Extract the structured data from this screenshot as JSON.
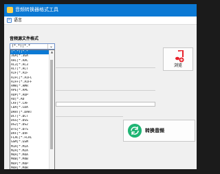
{
  "window": {
    "title": "音频转换器格式工具"
  },
  "menu": {
    "language_label": "语言"
  },
  "format_section": {
    "title": "音频源文件格式",
    "selected_value": "(*.*)|*.*",
    "options": [
      "(*.*)|*.*",
      "3GA|*.3GA",
      "AAC|*.AAC",
      "AC3|*.AC3",
      "ACT|*.ACT",
      "AIF|*.AIF",
      "AIFC|*.AIFC",
      "AIFF|*.AIFF",
      "AMR|*.AMR",
      "APE|*.APE",
      "AUP|*.AUP",
      "AU|*.AU",
      "CAF|*.CAF",
      "CDA|*.CDA",
      "DART|*.DART",
      "DCT|*.DCT",
      "DSS|*.DSS",
      "DS2|*.DS2",
      "DTS|*.DTS",
      "DVF|*.DVF",
      "FLAC|*.FLAC",
      "GSM|*.GSM",
      "M1A|*.M1A",
      "M2A|*.M2A",
      "M4A|*.M4A",
      "M4B|*.M4B",
      "M4P|*.M4P",
      "M4R|*.M4R",
      "MKA|*.MKA"
    ]
  },
  "buttons": {
    "browse_label": "浏览",
    "convert_label": "转换音频"
  },
  "colors": {
    "titlebar": "#0b79d4",
    "selection": "#0b79d4",
    "convert_icon": "#1fb574",
    "music_icon": "#e8202a"
  }
}
